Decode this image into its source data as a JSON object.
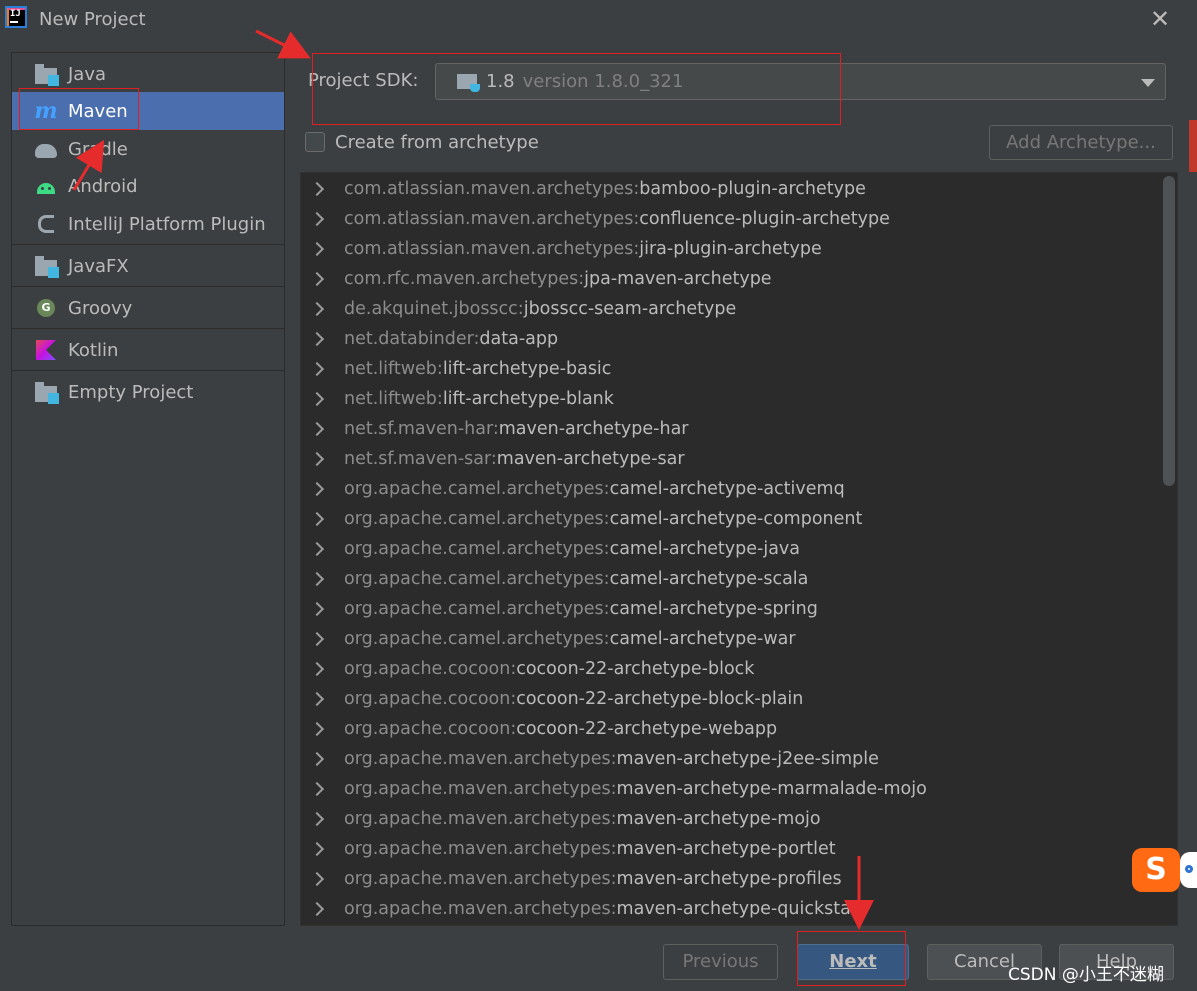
{
  "window": {
    "app_icon_text": "IJ",
    "title": "New Project",
    "close_glyph": "✕"
  },
  "sidebar": {
    "items": [
      {
        "label": "Java",
        "icon": "folder-icon",
        "selected": false
      },
      {
        "label": "Maven",
        "icon": "maven-icon",
        "selected": true
      },
      {
        "label": "Gradle",
        "icon": "gradle-icon",
        "selected": false
      },
      {
        "label": "Android",
        "icon": "android-icon",
        "selected": false
      },
      {
        "label": "IntelliJ Platform Plugin",
        "icon": "plugin-icon",
        "selected": false
      },
      {
        "label": "JavaFX",
        "icon": "folder-icon",
        "selected": false
      },
      {
        "label": "Groovy",
        "icon": "groovy-icon",
        "selected": false
      },
      {
        "label": "Kotlin",
        "icon": "kotlin-icon",
        "selected": false
      },
      {
        "label": "Empty Project",
        "icon": "folder-icon",
        "selected": false
      }
    ]
  },
  "sdk": {
    "label": "Project SDK:",
    "name": "1.8",
    "version": "version 1.8.0_321"
  },
  "archetype": {
    "checkbox_label": "Create from archetype",
    "checked": false,
    "add_button": "Add Archetype..."
  },
  "archetypes": [
    {
      "group": "com.atlassian.maven.archetypes:",
      "artifact": "bamboo-plugin-archetype"
    },
    {
      "group": "com.atlassian.maven.archetypes:",
      "artifact": "confluence-plugin-archetype"
    },
    {
      "group": "com.atlassian.maven.archetypes:",
      "artifact": "jira-plugin-archetype"
    },
    {
      "group": "com.rfc.maven.archetypes:",
      "artifact": "jpa-maven-archetype"
    },
    {
      "group": "de.akquinet.jbosscc:",
      "artifact": "jbosscc-seam-archetype"
    },
    {
      "group": "net.databinder:",
      "artifact": "data-app"
    },
    {
      "group": "net.liftweb:",
      "artifact": "lift-archetype-basic"
    },
    {
      "group": "net.liftweb:",
      "artifact": "lift-archetype-blank"
    },
    {
      "group": "net.sf.maven-har:",
      "artifact": "maven-archetype-har"
    },
    {
      "group": "net.sf.maven-sar:",
      "artifact": "maven-archetype-sar"
    },
    {
      "group": "org.apache.camel.archetypes:",
      "artifact": "camel-archetype-activemq"
    },
    {
      "group": "org.apache.camel.archetypes:",
      "artifact": "camel-archetype-component"
    },
    {
      "group": "org.apache.camel.archetypes:",
      "artifact": "camel-archetype-java"
    },
    {
      "group": "org.apache.camel.archetypes:",
      "artifact": "camel-archetype-scala"
    },
    {
      "group": "org.apache.camel.archetypes:",
      "artifact": "camel-archetype-spring"
    },
    {
      "group": "org.apache.camel.archetypes:",
      "artifact": "camel-archetype-war"
    },
    {
      "group": "org.apache.cocoon:",
      "artifact": "cocoon-22-archetype-block"
    },
    {
      "group": "org.apache.cocoon:",
      "artifact": "cocoon-22-archetype-block-plain"
    },
    {
      "group": "org.apache.cocoon:",
      "artifact": "cocoon-22-archetype-webapp"
    },
    {
      "group": "org.apache.maven.archetypes:",
      "artifact": "maven-archetype-j2ee-simple"
    },
    {
      "group": "org.apache.maven.archetypes:",
      "artifact": "maven-archetype-marmalade-mojo"
    },
    {
      "group": "org.apache.maven.archetypes:",
      "artifact": "maven-archetype-mojo"
    },
    {
      "group": "org.apache.maven.archetypes:",
      "artifact": "maven-archetype-portlet"
    },
    {
      "group": "org.apache.maven.archetypes:",
      "artifact": "maven-archetype-profiles"
    },
    {
      "group": "org.apache.maven.archetypes:",
      "artifact": "maven-archetype-quickstart"
    }
  ],
  "buttons": {
    "previous": "Previous",
    "next": "Next",
    "cancel": "Cancel",
    "help": "Help"
  },
  "watermark": "CSDN @小王不迷糊",
  "overlay": {
    "sogou_glyph": "S"
  },
  "colors": {
    "background": "#3c3f41",
    "list_background": "#2b2b2b",
    "selection": "#4b6eaf",
    "primary_button": "#365880",
    "annotation_red": "#e02020"
  }
}
